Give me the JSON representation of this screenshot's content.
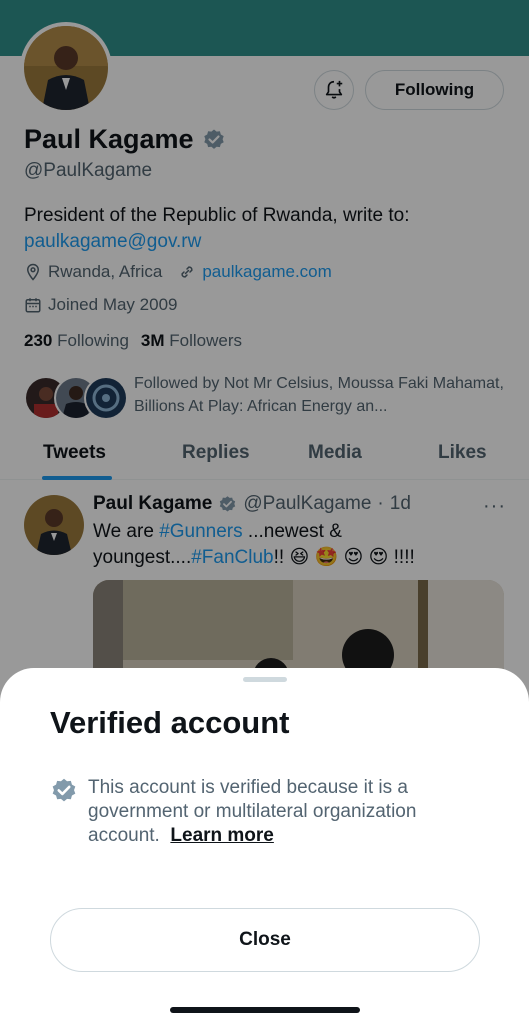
{
  "profile": {
    "name": "Paul Kagame",
    "handle": "@PaulKagame",
    "bio": "President of the Republic of Rwanda, write to:",
    "bio_link": "paulkagame@gov.rw",
    "location": "Rwanda, Africa",
    "website": "paulkagame.com",
    "joined": "Joined May 2009",
    "following_count": "230",
    "following_label": "Following",
    "followers_count": "3M",
    "followers_label": "Followers",
    "followed_by": "Followed by Not Mr Celsius, Moussa Faki Mahamat, Billions At Play: African Energy an..."
  },
  "actions": {
    "following_button": "Following",
    "notify_icon": "bell-plus-icon"
  },
  "tabs": [
    {
      "label": "Tweets",
      "active": true
    },
    {
      "label": "Replies",
      "active": false
    },
    {
      "label": "Media",
      "active": false
    },
    {
      "label": "Likes",
      "active": false
    }
  ],
  "tweet": {
    "author": "Paul Kagame",
    "handle": "@PaulKagame",
    "separator": "·",
    "time": "1d",
    "more": "···",
    "text_prefix": "We are ",
    "hashtag1": "#Gunners",
    "text_middle": " ...newest & youngest....",
    "hashtag2": "#FanClub",
    "text_suffix": "!! 😆 🤩 😍 😍 !!!!"
  },
  "sheet": {
    "title": "Verified account",
    "description": "This account is verified because it is a government or multilateral organization account.",
    "learn_more": "Learn more",
    "close_button": "Close"
  },
  "colors": {
    "banner": "#2f8f8a",
    "accent": "#1d9bf0",
    "verified_badge": "#829aab",
    "text_primary": "#0f1419",
    "text_secondary": "#536471"
  }
}
